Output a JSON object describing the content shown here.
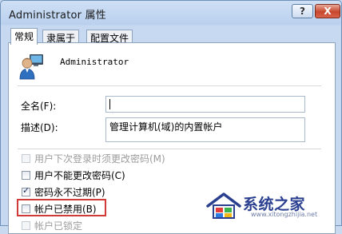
{
  "window": {
    "title": "Administrator 属性",
    "help_label": "?",
    "close_label": "X"
  },
  "tabs": [
    {
      "label": "常规",
      "active": true
    },
    {
      "label": "隶属于",
      "active": false
    },
    {
      "label": "配置文件",
      "active": false
    }
  ],
  "user": {
    "name": "Administrator",
    "icon": "user-account-icon"
  },
  "fields": {
    "fullname_label": "全名(F):",
    "fullname_value": "",
    "description_label": "描述(D):",
    "description_value": "管理计算机(域)的内置帐户"
  },
  "checkboxes": [
    {
      "label": "用户下次登录时须更改密码(M)",
      "checked": false,
      "disabled": true
    },
    {
      "label": "用户不能更改密码(C)",
      "checked": false,
      "disabled": false
    },
    {
      "label": "密码永不过期(P)",
      "checked": true,
      "disabled": false
    },
    {
      "label": "帐户已禁用(B)",
      "checked": false,
      "disabled": false
    },
    {
      "label": "帐户已锁定",
      "checked": false,
      "disabled": true
    }
  ],
  "checkmark": "✓",
  "watermark": {
    "text": "系统之家",
    "url": "www.xitongzhijia.net",
    "logo_icon": "house-logo-icon"
  },
  "colors": {
    "highlight": "#d23a3a",
    "title_bar": "#b9d0ee"
  }
}
